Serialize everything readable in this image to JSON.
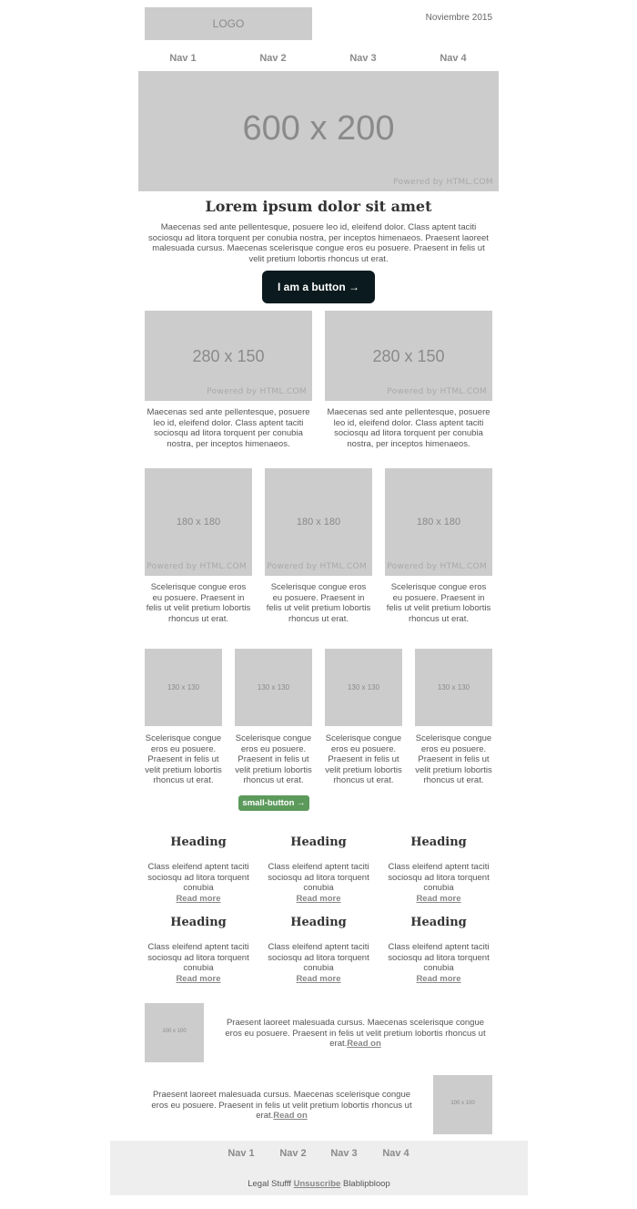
{
  "header": {
    "logo": "LOGO",
    "date": "Noviembre 2015"
  },
  "nav": [
    "Nav 1",
    "Nav 2",
    "Nav 3",
    "Nav 4"
  ],
  "hero": {
    "size_label": "600 x 200",
    "powered": "Powered by HTML.COM"
  },
  "intro": {
    "title": "Lorem ipsum dolor sit amet",
    "text_lines": [
      "Maecenas sed ante pellentesque, posuere leo id, eleifend dolor. Class aptent taciti",
      "sociosqu ad litora torquent per conubia nostra, per inceptos himenaeos. Praesent laoreet",
      "malesuada cursus. Maecenas scelerisque congue eros eu posuere. Praesent in felis ut",
      "velit pretium lobortis rhoncus ut erat."
    ],
    "button": "I am a button →"
  },
  "two_col": {
    "size_label": "280 x 150",
    "powered": "Powered by HTML.COM",
    "text_lines": [
      "Maecenas sed ante pellentesque, posuere",
      "leo id, eleifend dolor. Class aptent taciti",
      "sociosqu ad litora torquent per conubia",
      "nostra, per inceptos himenaeos."
    ]
  },
  "three_col": {
    "size_label": "180 x 180",
    "powered": "Powered by HTML.COM",
    "text_lines": [
      "Scelerisque congue eros",
      "eu posuere. Praesent in",
      "felis ut velit pretium lobortis",
      "rhoncus ut erat."
    ]
  },
  "four_col": {
    "size_label": "130 x 130",
    "text_lines": [
      "Scelerisque congue",
      "eros eu posuere.",
      "Praesent in felis ut",
      "velit pretium lobortis",
      "rhoncus ut erat."
    ],
    "small_button": "small-button →"
  },
  "headings_grid": {
    "heading": "Heading",
    "text_lines": [
      "Class eleifend aptent taciti",
      "sociosqu ad litora torquent",
      "conubia"
    ],
    "read_more": "Read more"
  },
  "media_rows": {
    "thumb_label": "100 x 100",
    "text_lines": [
      "Praesent laoreet malesuada cursus. Maecenas scelerisque congue",
      "eros eu posuere. Praesent in felis ut velit pretium lobortis rhoncus ut",
      "erat."
    ],
    "read_on": "Read on"
  },
  "footer": {
    "nav": [
      "Nav 1",
      "Nav 2",
      "Nav 3",
      "Nav 4"
    ],
    "legal": "Legal Stufff",
    "unsubscribe": "Unsuscribe",
    "tail": "Blablipbloop"
  }
}
